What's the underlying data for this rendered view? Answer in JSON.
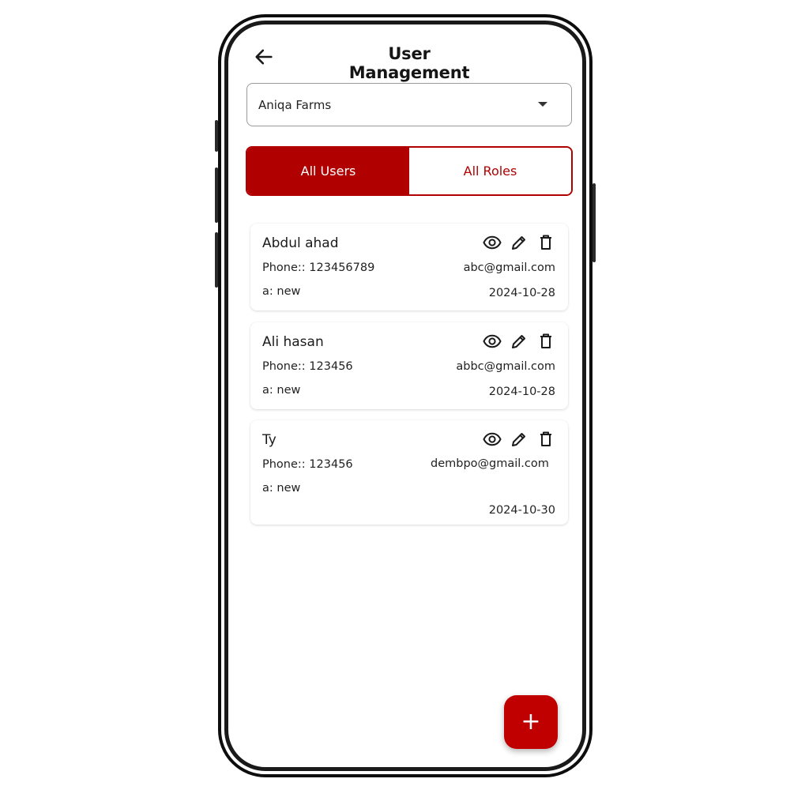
{
  "header": {
    "title": "User Management",
    "back_icon": "arrow-left-icon"
  },
  "farm_select": {
    "value": "Aniqa Farms",
    "icon": "caret-down-icon"
  },
  "tabs": [
    {
      "label": "All Users",
      "active": true
    },
    {
      "label": "All Roles",
      "active": false
    }
  ],
  "users": [
    {
      "name": "Abdul ahad",
      "phone": "Phone:: 123456789",
      "role": "a: new",
      "email": "abc@gmail.com",
      "date": "2024-10-28"
    },
    {
      "name": "Ali hasan",
      "phone": "Phone:: 123456",
      "role": "a: new",
      "email": "abbc@gmail.com",
      "date": "2024-10-28"
    },
    {
      "name": "Ty",
      "phone": "Phone:: 123456",
      "role": "a: new",
      "email": "dembpo@gmail.com",
      "date": "2024-10-30"
    }
  ],
  "card_actions": [
    "eye-icon",
    "pencil-icon",
    "trash-icon"
  ],
  "fab": {
    "label": "+",
    "icon": "plus-icon"
  },
  "colors": {
    "accent": "#b00000",
    "fab": "#c00000",
    "text": "#1b1b1b",
    "background": "#ffffff"
  }
}
